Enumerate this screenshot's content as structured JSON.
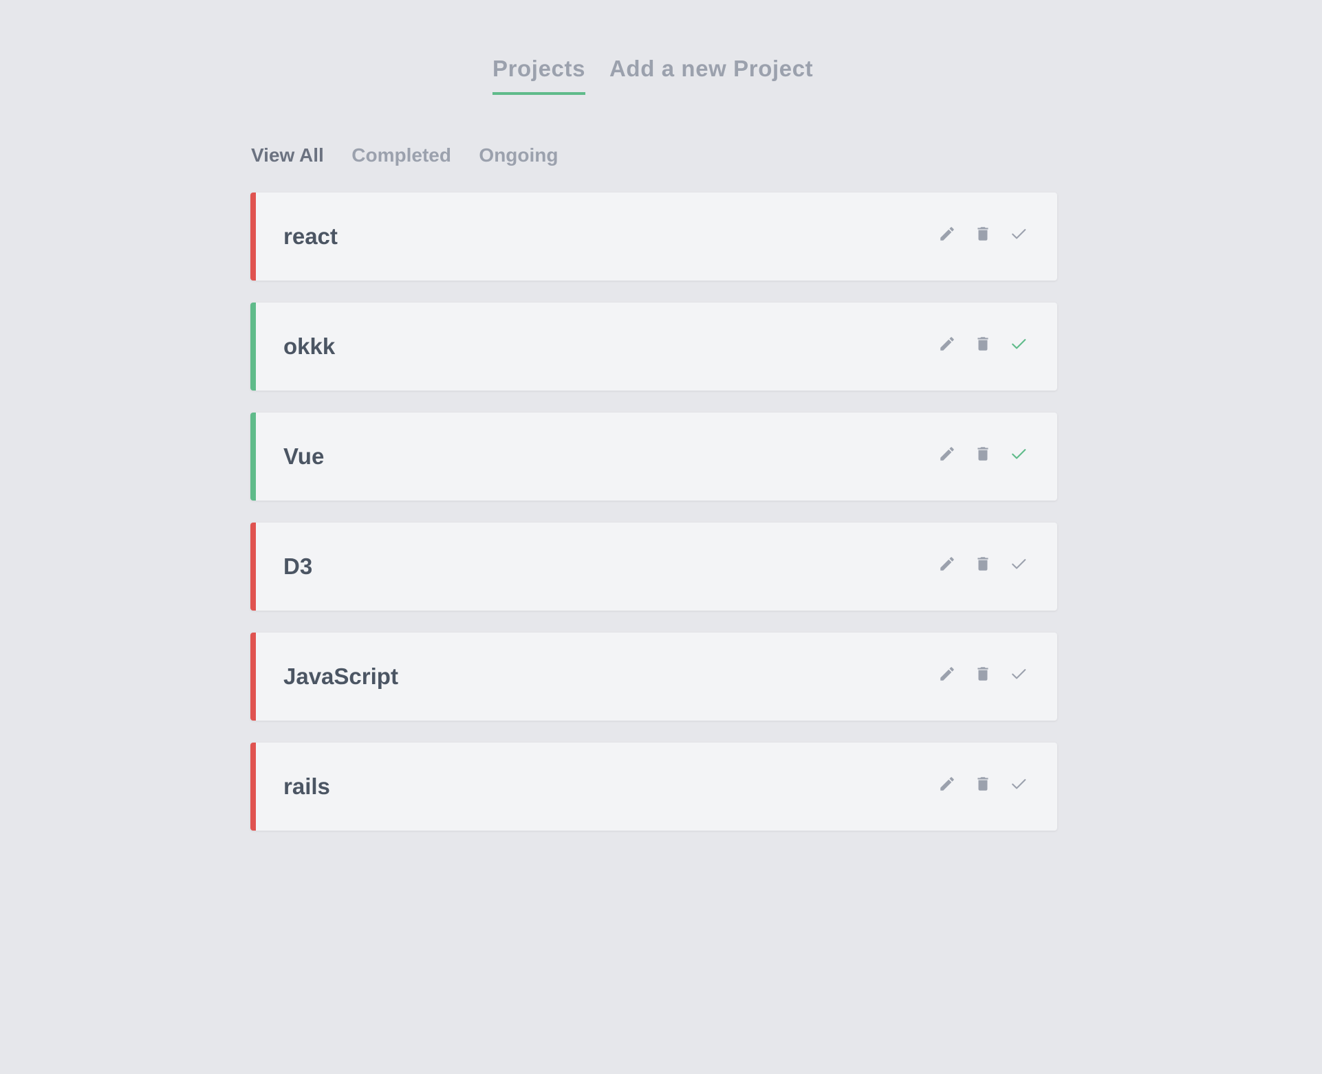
{
  "nav": {
    "projects_label": "Projects",
    "add_label": "Add a new Project"
  },
  "filters": {
    "all": "View All",
    "completed": "Completed",
    "ongoing": "Ongoing"
  },
  "colors": {
    "background": "#e6e7eb",
    "card": "#f3f4f6",
    "completed_accent": "#5fbb8a",
    "ongoing_accent": "#e05350",
    "icon_gray": "#9ba1ad"
  },
  "projects": [
    {
      "title": "react",
      "completed": false
    },
    {
      "title": "okkk",
      "completed": true
    },
    {
      "title": "Vue",
      "completed": true
    },
    {
      "title": "D3",
      "completed": false
    },
    {
      "title": "JavaScript",
      "completed": false
    },
    {
      "title": "rails",
      "completed": false
    }
  ],
  "icons": {
    "edit": "pencil-icon",
    "delete": "trash-icon",
    "complete": "check-icon"
  }
}
